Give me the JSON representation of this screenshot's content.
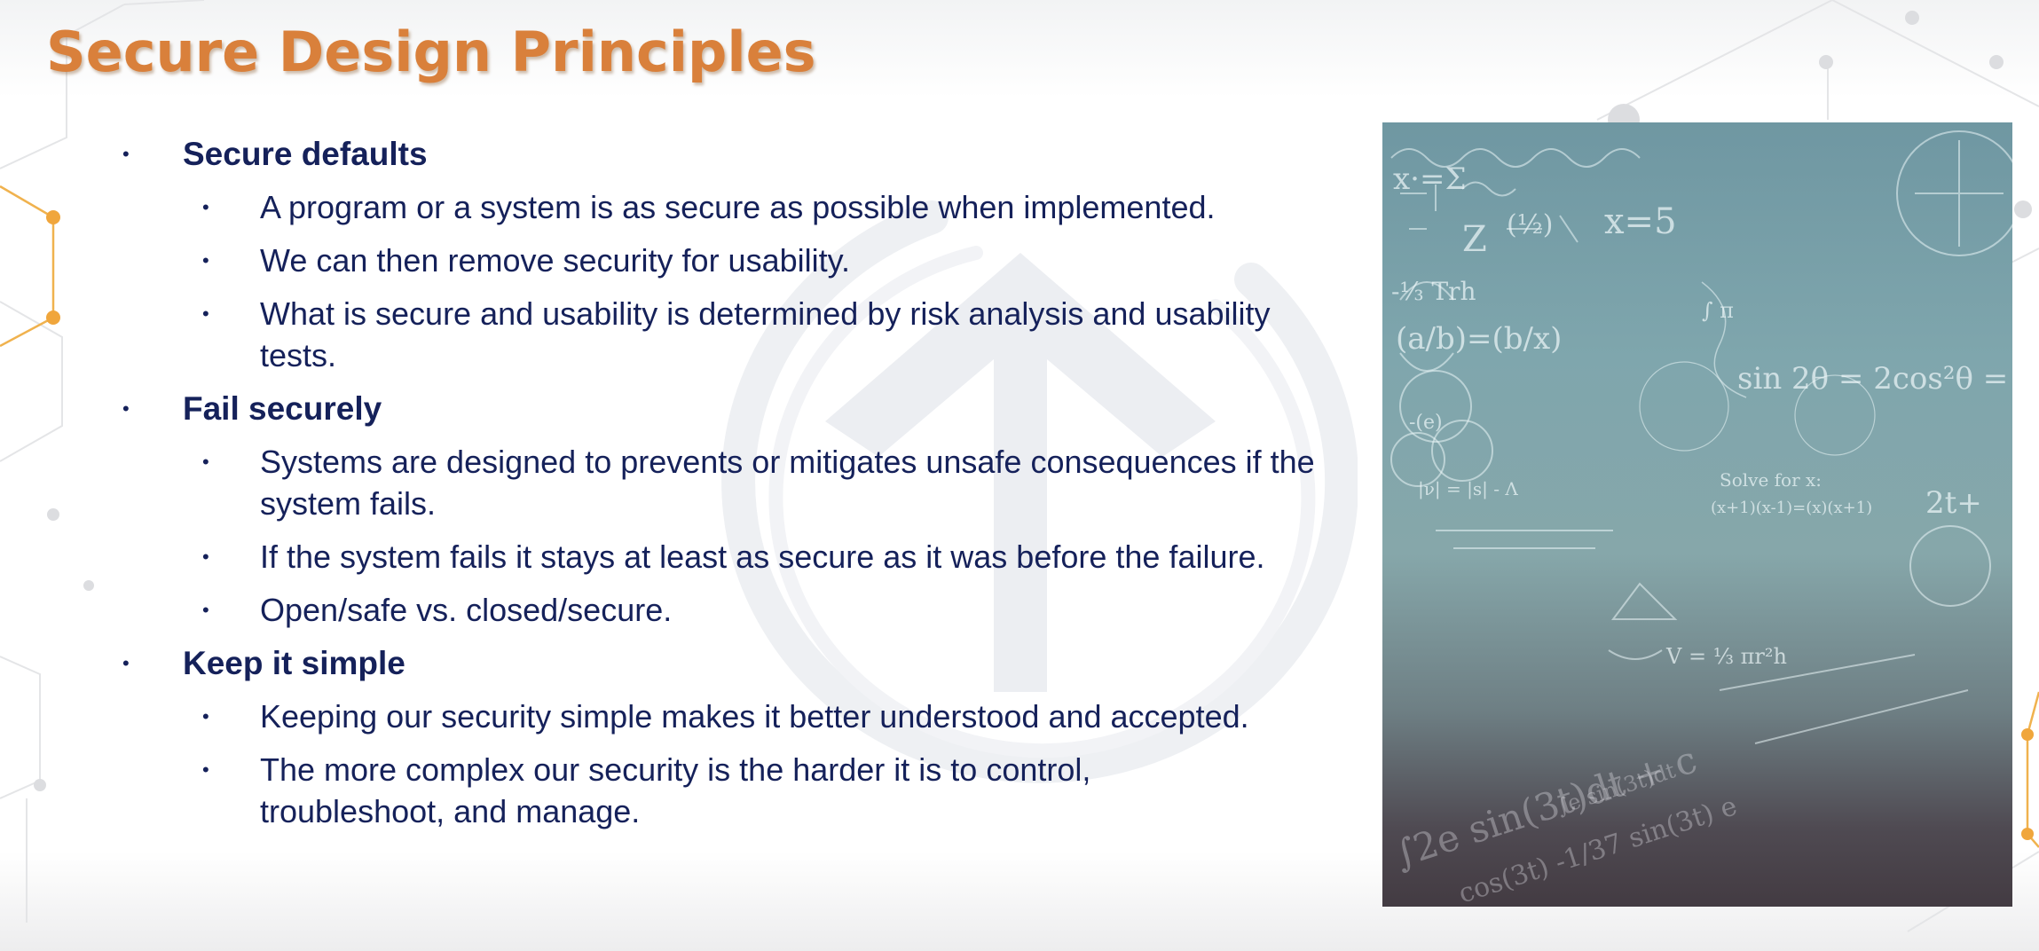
{
  "slide": {
    "title": "Secure Design Principles",
    "colors": {
      "title": "#d9803b",
      "text": "#15215a",
      "background": "#ffffff",
      "accent_network": "#e8a23b"
    },
    "sections": [
      {
        "heading": "Secure defaults",
        "points": [
          "A program or a system is as secure as possible when implemented.",
          "We can then remove security for usability.",
          "What is secure and usability is determined by risk analysis and usability tests."
        ]
      },
      {
        "heading": "Fail securely",
        "points": [
          "Systems are designed to prevents or mitigates unsafe consequences if the system fails.",
          "If the system fails it stays at least as secure as it was before the failure.",
          "Open/safe vs. closed/secure."
        ]
      },
      {
        "heading": "Keep it simple",
        "points": [
          "Keeping our security simple makes it better understood and accepted.",
          "The more complex our security is the harder it is to control, troubleshoot, and manage."
        ]
      }
    ],
    "bullet_glyph": "•",
    "image": {
      "icon": "math-chalkboard-image"
    }
  }
}
